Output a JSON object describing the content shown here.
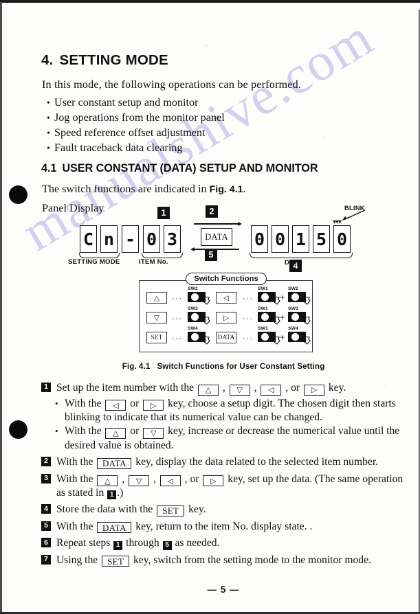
{
  "document": {
    "chapter_number": "4.",
    "chapter_title": "SETTING MODE",
    "intro": "In this mode, the following operations can be performed.",
    "bullets": [
      "User constant setup and monitor",
      "Jog operations from the monitor panel",
      "Speed reference offset adjustment",
      "Fault traceback data clearing"
    ],
    "section_number": "4.1",
    "section_title": "USER CONSTANT (DATA) SETUP AND MONITOR",
    "sub_intro_pre": "The switch functions are indicated in ",
    "sub_intro_ref": "Fig. 4.1",
    "sub_intro_post": ".",
    "panel_display_label": "Panel Display",
    "page_number": "— 5 —",
    "watermark": "manualshive.com"
  },
  "figure": {
    "left_display": {
      "digits": [
        "C",
        "n",
        "-",
        "0",
        "3"
      ],
      "mode_caption": "SETTING MODE",
      "item_caption": "ITEM No."
    },
    "center_key": {
      "label": "DATA",
      "marker_above": "2",
      "marker_below": "5"
    },
    "right_display": {
      "digits": [
        "0",
        "0",
        "1",
        "5",
        "0"
      ],
      "data_caption": "DATA",
      "blink_caption": "BLINK",
      "marker_below": "4"
    },
    "marker_item_no": "1",
    "switch_box": {
      "title": "Switch Functions",
      "dots": "···",
      "plus": "+",
      "rows": [
        {
          "left_key": "△",
          "left_switches": [
            "SW2"
          ],
          "mid_key": "◁",
          "mid_switches": [
            "SW1",
            "SW2"
          ]
        },
        {
          "left_key": "▽",
          "left_switches": [
            "SW3"
          ],
          "mid_key": "▷",
          "mid_switches": [
            "SW1",
            "SW3"
          ]
        },
        {
          "left_key": "SET",
          "left_switches": [
            "SW4"
          ],
          "mid_key": "DATA",
          "mid_switches": [
            "SW1",
            "SW4"
          ]
        }
      ]
    },
    "caption_label": "Fig. 4.1",
    "caption_text": "Switch Functions for User Constant Setting"
  },
  "steps": {
    "step1": {
      "marker": "1",
      "text_a": "Set up the item number with the ",
      "key_up": "△",
      "sep1": " , ",
      "key_down": "▽",
      "sep2": " , ",
      "key_left": "◁",
      "sep3": " , or ",
      "key_right": "▷",
      "text_b": " key.",
      "sub_a_1": "With the ",
      "sub_a_key1": "◁",
      "sub_a_mid": " or ",
      "sub_a_key2": "▷",
      "sub_a_2": " key, choose a setup digit.   The chosen digit then starts blinking to indicate that its numerical value can be changed.",
      "sub_b_1": "With the ",
      "sub_b_key1": "△",
      "sub_b_mid": " or ",
      "sub_b_key2": "▽",
      "sub_b_2": " key, increase or decrease the numerical value until the desired value is obtained."
    },
    "step2": {
      "marker": "2",
      "text_a": "With the ",
      "key": "DATA",
      "text_b": " key, display the data related to the selected item number."
    },
    "step3": {
      "marker": "3",
      "text_a": "With the ",
      "key_up": "△",
      "sep1": " , ",
      "key_down": "▽",
      "sep2": " , ",
      "key_left": "◁",
      "sep3": " , or ",
      "key_right": "▷",
      "text_b": " key, set up the data. (The same operation as stated in ",
      "ref_marker": "1",
      "text_c": ".)"
    },
    "step4": {
      "marker": "4",
      "text_a": "Store the data with the ",
      "key": "SET",
      "text_b": " key."
    },
    "step5": {
      "marker": "5",
      "text_a": "With the ",
      "key": "DATA",
      "text_b": " key, return to the item No. display state. ."
    },
    "step6": {
      "marker": "6",
      "text_a": "Repeat steps ",
      "ref_from": "1",
      "text_b": " through ",
      "ref_to": "5",
      "text_c": " as needed."
    },
    "step7": {
      "marker": "7",
      "text_a": "Using the ",
      "key": "SET",
      "text_b": " key, switch from the setting mode to the monitor mode."
    }
  }
}
